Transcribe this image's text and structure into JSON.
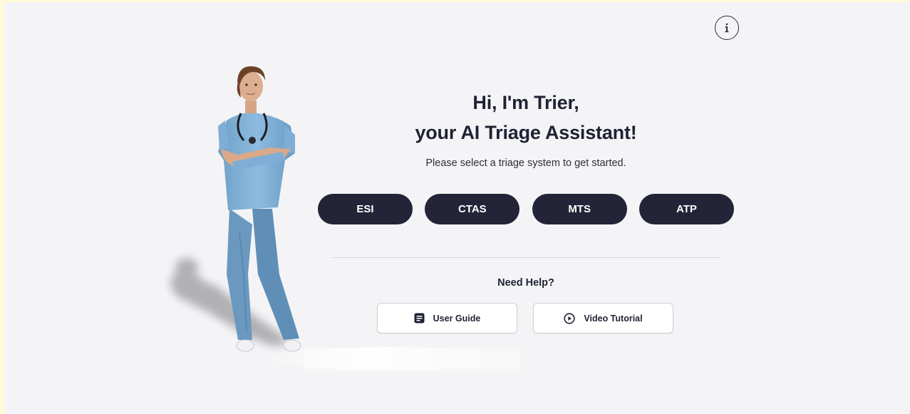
{
  "app": {
    "info_icon": "info-circle-icon",
    "assistant_avatar": "nurse-avatar"
  },
  "hero": {
    "title_line1": "Hi, I'm Trier,",
    "title_line2": "your AI Triage Assistant!",
    "subtitle": "Please select a triage system to get started."
  },
  "triage_systems": [
    {
      "label": "ESI"
    },
    {
      "label": "CTAS"
    },
    {
      "label": "MTS"
    },
    {
      "label": "ATP"
    }
  ],
  "help": {
    "title": "Need Help?",
    "buttons": [
      {
        "label": "User Guide",
        "icon": "document-icon"
      },
      {
        "label": "Video Tutorial",
        "icon": "play-circle-icon"
      }
    ]
  },
  "colors": {
    "background": "#f4f4f6",
    "primary_button": "#232438",
    "text_dark": "#1f2233",
    "outer_frame": "#fffbd6",
    "scrubs": "#7fb0d6"
  }
}
